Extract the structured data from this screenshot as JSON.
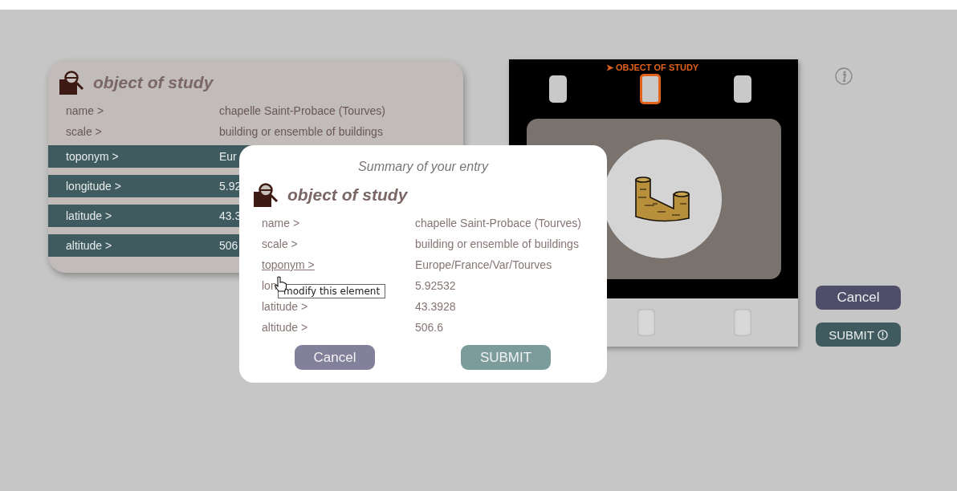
{
  "record_panel": {
    "title": "object of study",
    "rows": [
      {
        "label": "name >",
        "value": "chapelle Saint-Probace (Tourves)",
        "highlighted": false
      },
      {
        "label": "scale >",
        "value": "building or ensemble of buildings",
        "highlighted": false
      },
      {
        "label": "toponym >",
        "value": "Eur",
        "highlighted": true
      },
      {
        "label": "longitude >",
        "value": "5.92",
        "highlighted": true
      },
      {
        "label": "latitude >",
        "value": "43.3",
        "highlighted": true
      },
      {
        "label": "altitude >",
        "value": "506",
        "highlighted": true
      }
    ]
  },
  "film_strip": {
    "heading": "➤ OBJECT OF STUDY",
    "slots": [
      {
        "selected": false
      },
      {
        "selected": true
      },
      {
        "selected": false
      }
    ]
  },
  "side_buttons": [
    {
      "label": "Cancel",
      "kind": "cancel"
    },
    {
      "label": "SUBMIT",
      "kind": "submit"
    }
  ],
  "summary_dialog": {
    "title": "Summary of your entry",
    "heading": "object of study",
    "rows": [
      {
        "label": "name >",
        "value": "chapelle Saint-Probace (Tourves)",
        "hovered": false
      },
      {
        "label": "scale >",
        "value": "building or ensemble of buildings",
        "hovered": false
      },
      {
        "label": "toponym >",
        "value": "Europe/France/Var/Tourves",
        "hovered": true
      },
      {
        "label": "lon",
        "value": "5.92532",
        "hovered": false
      },
      {
        "label": "latitude >",
        "value": "43.3928",
        "hovered": false
      },
      {
        "label": "altitude >",
        "value": "506.6",
        "hovered": false
      }
    ],
    "tooltip": "modify this element",
    "buttons": [
      {
        "label": "Cancel",
        "kind": "cancel"
      },
      {
        "label": "SUBMIT",
        "kind": "submit"
      }
    ]
  }
}
